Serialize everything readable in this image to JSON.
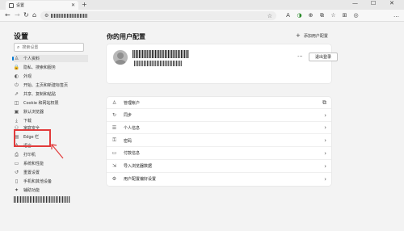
{
  "browser": {
    "tab_title": "设置",
    "tab_close": "✕",
    "new_tab": "+",
    "window_controls": [
      "—",
      "☐",
      "✕"
    ],
    "nav": {
      "back": "←",
      "forward": "→",
      "refresh": "↻",
      "home": "⌂"
    },
    "address_icon": "⚙",
    "toolbar_icons": [
      "A",
      "☆",
      "◑",
      "⊕",
      "⧉",
      "☆",
      "⊞",
      "◎",
      "…"
    ]
  },
  "sidebar": {
    "title": "设置",
    "search_placeholder": "搜索设置",
    "items": [
      {
        "label": "个人资料",
        "icon": "person-icon",
        "glyph": "♙",
        "active": true
      },
      {
        "label": "隐私、搜索和服务",
        "icon": "lock-icon",
        "glyph": "🔒"
      },
      {
        "label": "外观",
        "icon": "palette-icon",
        "glyph": "◐"
      },
      {
        "label": "开始、主页和新建标签页",
        "icon": "power-icon",
        "glyph": "⏻"
      },
      {
        "label": "共享、复制和粘贴",
        "icon": "share-icon",
        "glyph": "⇗"
      },
      {
        "label": "Cookie 和网站权限",
        "icon": "cookie-icon",
        "glyph": "◫"
      },
      {
        "label": "默认浏览器",
        "icon": "browser-icon",
        "glyph": "▣"
      },
      {
        "label": "下载",
        "icon": "download-icon",
        "glyph": "⤓"
      },
      {
        "label": "家庭安全",
        "icon": "family-icon",
        "glyph": "⚇"
      },
      {
        "label": "Edge 栏",
        "icon": "edge-bar-icon",
        "glyph": "▤"
      },
      {
        "label": "语言",
        "icon": "language-icon",
        "glyph": "A"
      },
      {
        "label": "打印机",
        "icon": "printer-icon",
        "glyph": "⎙"
      },
      {
        "label": "系统和性能",
        "icon": "system-icon",
        "glyph": "▭"
      },
      {
        "label": "重置设置",
        "icon": "reset-icon",
        "glyph": "↺"
      },
      {
        "label": "手机和其他设备",
        "icon": "phone-icon",
        "glyph": "▯"
      },
      {
        "label": "辅助功能",
        "icon": "accessibility-icon",
        "glyph": "✦"
      }
    ]
  },
  "main": {
    "title": "你的用户配置",
    "add_profile": "添加用户配置",
    "profile": {
      "more_label": "···",
      "sign_out": "退出登录"
    },
    "rows": [
      {
        "label": "管理帐户",
        "icon": "account-icon",
        "glyph": "♙",
        "trail": "⧉"
      },
      {
        "label": "同步",
        "icon": "sync-icon",
        "glyph": "↻",
        "trail": "›"
      },
      {
        "label": "个人信息",
        "icon": "personal-info-icon",
        "glyph": "☰",
        "trail": "›"
      },
      {
        "label": "密码",
        "icon": "key-icon",
        "glyph": "⚿",
        "trail": "›"
      },
      {
        "label": "付款信息",
        "icon": "card-icon",
        "glyph": "▭",
        "trail": "›"
      },
      {
        "label": "导入浏览器数据",
        "icon": "import-icon",
        "glyph": "⇲",
        "trail": "›"
      },
      {
        "label": "用户配置偏好设置",
        "icon": "profile-prefs-icon",
        "glyph": "⚙",
        "trail": "›"
      }
    ]
  },
  "annotation": {
    "color": "#e23a3a"
  }
}
